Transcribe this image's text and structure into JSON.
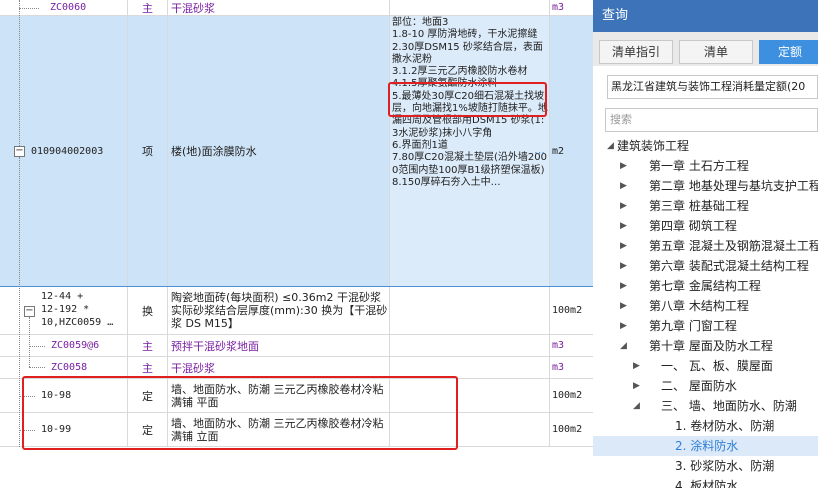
{
  "table": {
    "row0": {
      "code": "ZC0060",
      "type": "主",
      "name": "干混砂浆",
      "unit": "m3"
    },
    "row1": {
      "code": "010904002003",
      "type": "项",
      "name": "楼(地)面涂膜防水",
      "features": "部位：地面3\n1.8-10 厚防滑地砖，干水泥擦缝\n2.30厚DSM15 砂浆结合层，表面撒水泥粉\n3.1.2厚三元乙丙橡胶防水卷材\n4.1.5厚聚氨酯防水涂料\n5.最薄处30厚C20细石混凝土找坡层，向地漏找1%坡随打随抹平。地漏四周及管根部用DSM15 砂浆(1:3水泥砂浆)抹小八字角\n6.界面剂1道\n7.80厚C20混凝土垫层(沿外墙2000范围内垫100厚B1级挤塑保温板)\n8.150厚碎石夯入土中…",
      "ellipsis": "⋯",
      "unit": "m2"
    },
    "row2": {
      "code_lines": [
        "12-44 +",
        "12-192 *",
        "10,HZC0059 …"
      ],
      "type": "换",
      "name": "陶瓷地面砖(每块面积) ≤0.36m2 干混砂浆 实际砂浆结合层厚度(mm):30 换为【干混砂浆 DS M15】",
      "unit": "100m2"
    },
    "row3": {
      "code": "ZC0059@6",
      "type": "主",
      "name": "预拌干混砂浆地面",
      "unit": "m3"
    },
    "row4": {
      "code": "ZC0058",
      "type": "主",
      "name": "干混砂浆",
      "unit": "m3"
    },
    "row5": {
      "code": "10-98",
      "type": "定",
      "name": "墙、地面防水、防潮 三元乙丙橡胶卷材冷粘满铺 平面",
      "unit": "100m2"
    },
    "row6": {
      "code": "10-99",
      "type": "定",
      "name": "墙、地面防水、防潮 三元乙丙橡胶卷材冷粘满铺 立面",
      "unit": "100m2"
    }
  },
  "panel": {
    "title": "查询",
    "tabs": [
      "清单指引",
      "清单",
      "定额"
    ],
    "active_tab": "定额",
    "quota_library": "黑龙江省建筑与装饰工程消耗量定额(20",
    "search_placeholder": "搜索",
    "tree": [
      {
        "label": "建筑装饰工程",
        "level": 0,
        "expanded": true
      },
      {
        "label": "第一章 土石方工程",
        "level": 1
      },
      {
        "label": "第二章 地基处理与基坑支护工程",
        "level": 1
      },
      {
        "label": "第三章 桩基础工程",
        "level": 1
      },
      {
        "label": "第四章 砌筑工程",
        "level": 1
      },
      {
        "label": "第五章 混凝土及钢筋混凝土工程",
        "level": 1
      },
      {
        "label": "第六章 装配式混凝土结构工程",
        "level": 1
      },
      {
        "label": "第七章 金属结构工程",
        "level": 1
      },
      {
        "label": "第八章 木结构工程",
        "level": 1
      },
      {
        "label": "第九章 门窗工程",
        "level": 1
      },
      {
        "label": "第十章 屋面及防水工程",
        "level": 1,
        "expanded": true
      },
      {
        "label": "一、 瓦、板、膜屋面",
        "level": 2
      },
      {
        "label": "二、 屋面防水",
        "level": 2
      },
      {
        "label": "三、 墙、地面防水、防潮",
        "level": 2,
        "expanded": true
      },
      {
        "label": "1. 卷材防水、防潮",
        "level": 3
      },
      {
        "label": "2. 涂料防水",
        "level": 3,
        "selected": true
      },
      {
        "label": "3. 砂浆防水、防潮",
        "level": 3
      },
      {
        "label": "4. 板材防水",
        "level": 3
      }
    ]
  },
  "colors": {
    "selection": "#cde3f7",
    "header_blue": "#3d73b8",
    "active_tab": "#3d8fe0",
    "main_material_text": "#7a1fa2",
    "highlight_box": "#e02020"
  }
}
